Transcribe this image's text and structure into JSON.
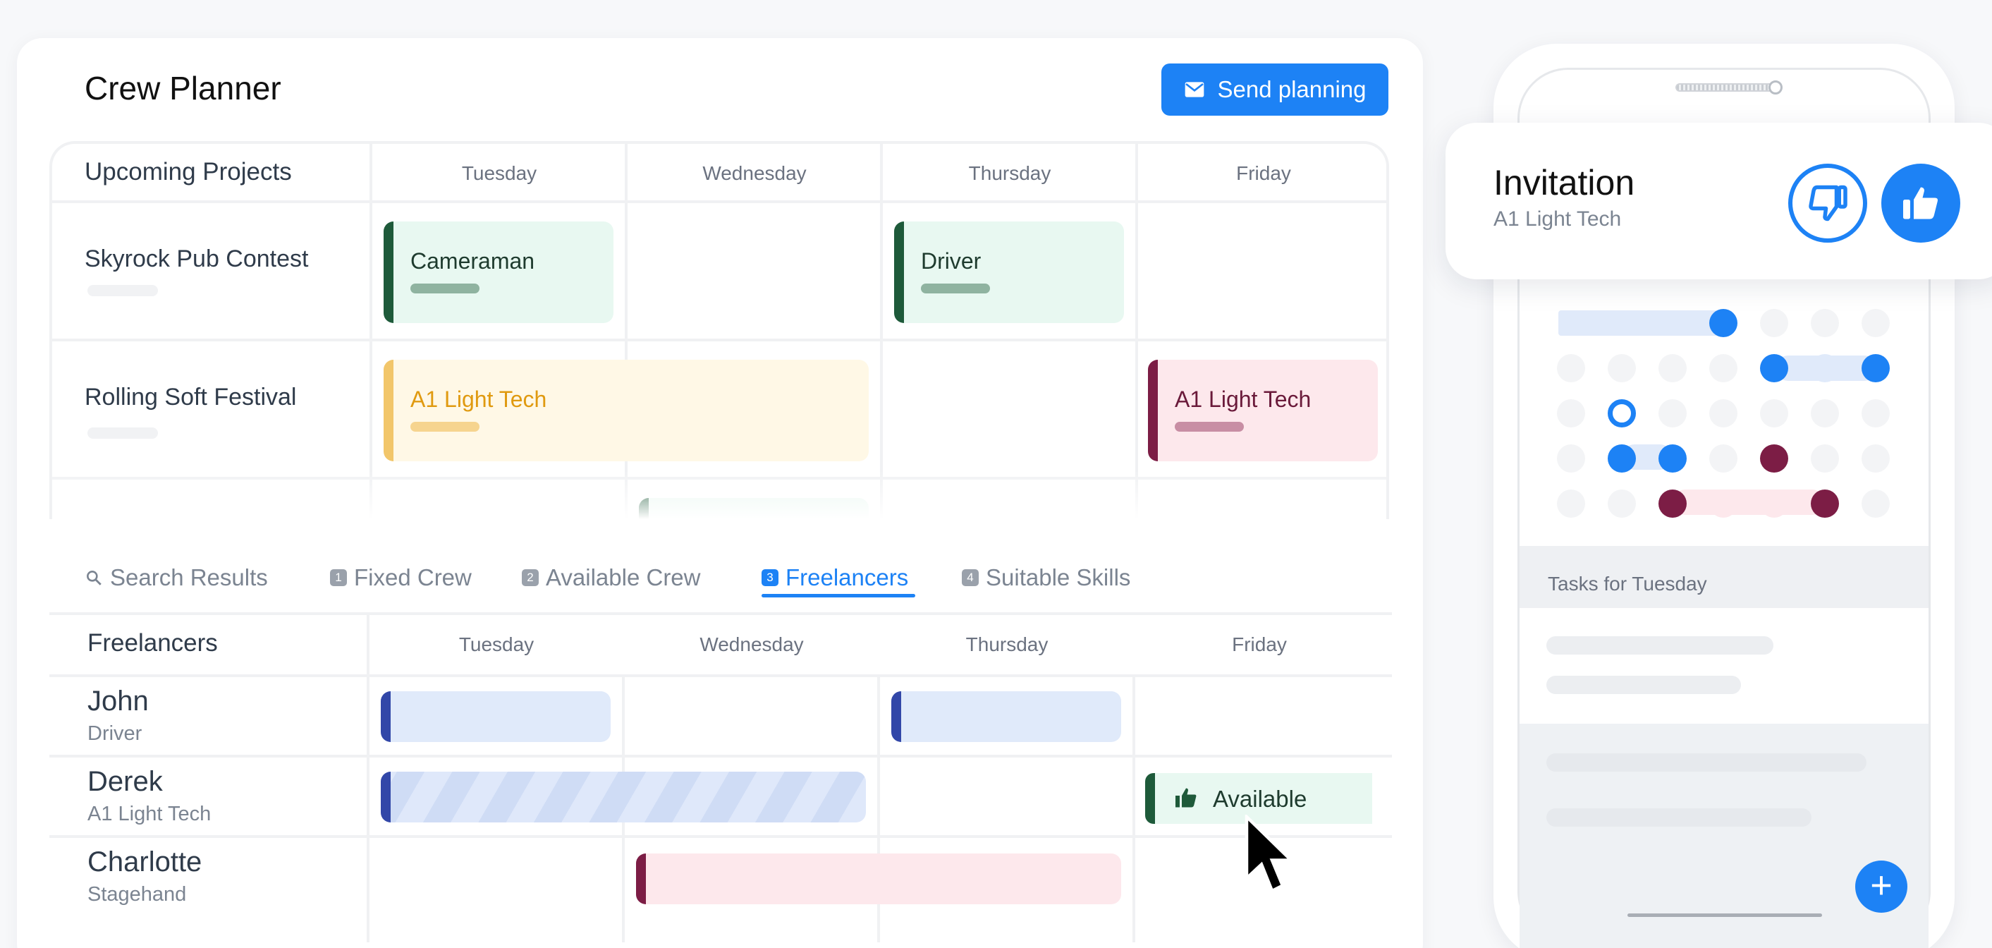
{
  "app": {
    "title": "Crew Planner",
    "send_button": "Send planning"
  },
  "projects": {
    "header": "Upcoming Projects",
    "days": [
      "Tuesday",
      "Wednesday",
      "Thursday",
      "Friday"
    ],
    "rows": [
      {
        "name": "Skyrock Pub Contest",
        "bars": [
          "Cameraman",
          "Driver"
        ]
      },
      {
        "name": "Rolling Soft Festival",
        "bars": [
          "A1 Light Tech",
          "A1 Light Tech"
        ]
      }
    ]
  },
  "tabs": [
    {
      "label": "Search Results",
      "icon": "search-icon"
    },
    {
      "num": "1",
      "label": "Fixed Crew"
    },
    {
      "num": "2",
      "label": "Available Crew"
    },
    {
      "num": "3",
      "label": "Freelancers",
      "active": true
    },
    {
      "num": "4",
      "label": "Suitable Skills"
    }
  ],
  "freelancers": {
    "header": "Freelancers",
    "days": [
      "Tuesday",
      "Wednesday",
      "Thursday",
      "Friday"
    ],
    "people": [
      {
        "name": "John",
        "role": "Driver"
      },
      {
        "name": "Derek",
        "role": "A1 Light Tech"
      },
      {
        "name": "Charlotte",
        "role": "Stagehand"
      }
    ],
    "available_label": "Available"
  },
  "phone": {
    "invitation_title": "Invitation",
    "invitation_subtitle": "A1 Light Tech",
    "tasks_header": "Tasks for Tuesday"
  },
  "colors": {
    "accent": "#1d82f5",
    "green": "#1e5a3a",
    "yellow": "#f2c66a",
    "wine": "#7c1d45",
    "navy": "#3247a8"
  }
}
